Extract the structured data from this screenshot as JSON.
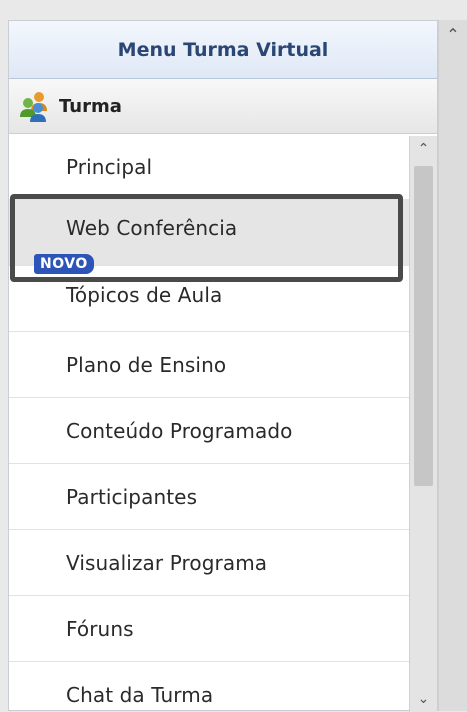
{
  "menu": {
    "title": "Menu Turma Virtual"
  },
  "section": {
    "title": "Turma",
    "icon": "group-users-icon"
  },
  "items": [
    {
      "label": "Principal"
    },
    {
      "label": "Web Conferência",
      "badge": "NOVO",
      "highlighted": true
    },
    {
      "label": "Tópicos de Aula"
    },
    {
      "label": "Plano de Ensino"
    },
    {
      "label": "Conteúdo Programado"
    },
    {
      "label": "Participantes"
    },
    {
      "label": "Visualizar Programa"
    },
    {
      "label": "Fóruns"
    },
    {
      "label": "Chat da Turma"
    }
  ],
  "colors": {
    "header_text": "#2a4675",
    "badge_bg": "#2d55b8",
    "highlight_border": "#4a4a4a"
  }
}
